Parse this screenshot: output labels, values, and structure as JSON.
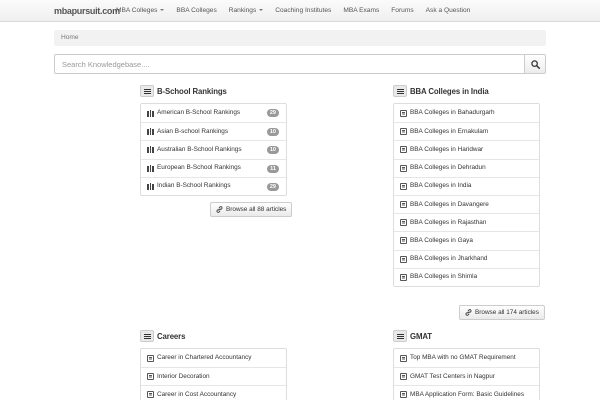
{
  "brand": "mbapursuit.com",
  "nav": [
    {
      "label": "MBA Colleges",
      "dropdown": true
    },
    {
      "label": "BBA Colleges",
      "dropdown": false
    },
    {
      "label": "Rankings",
      "dropdown": true
    },
    {
      "label": "Coaching Institutes",
      "dropdown": false
    },
    {
      "label": "MBA Exams",
      "dropdown": false
    },
    {
      "label": "Forums",
      "dropdown": false
    },
    {
      "label": "Ask a Question",
      "dropdown": false
    }
  ],
  "breadcrumb": "Home",
  "search": {
    "placeholder": "Search Knowledgebase...."
  },
  "sections": {
    "rankings": {
      "title": "B-School Rankings",
      "items": [
        {
          "label": "American B-School Rankings",
          "count": "29"
        },
        {
          "label": "Asian B-school Rankings",
          "count": "10"
        },
        {
          "label": "Australian B-School Rankings",
          "count": "10"
        },
        {
          "label": "European B-School Rankings",
          "count": "11"
        },
        {
          "label": "Indian B-School Rankings",
          "count": "29"
        }
      ],
      "browse": "Browse all 88 articles"
    },
    "bba": {
      "title": "BBA Colleges in India",
      "items": [
        {
          "label": "BBA Colleges in Bahadurgarh"
        },
        {
          "label": "BBA Colleges in Ernakulam"
        },
        {
          "label": "BBA Colleges in Haridwar"
        },
        {
          "label": "BBA Colleges in Dehradun"
        },
        {
          "label": "BBA Colleges in India"
        },
        {
          "label": "BBA Colleges in Davangere"
        },
        {
          "label": "BBA Colleges in Rajasthan"
        },
        {
          "label": "BBA Colleges in Gaya"
        },
        {
          "label": "BBA Colleges in Jharkhand"
        },
        {
          "label": "BBA Colleges in Shimla"
        }
      ],
      "browse": "Browse all 174 articles"
    },
    "careers": {
      "title": "Careers",
      "items": [
        {
          "label": "Career in Chartered Accountancy"
        },
        {
          "label": "Interior Decoration"
        },
        {
          "label": "Career in Cost Accountancy"
        }
      ]
    },
    "gmat": {
      "title": "GMAT",
      "items": [
        {
          "label": "Top MBA with no GMAT Requirement"
        },
        {
          "label": "GMAT Test Centers in Nagpur"
        },
        {
          "label": "MBA Application Form: Basic Guidelines"
        }
      ]
    }
  },
  "icons": {
    "search": "search-icon",
    "section": "list-icon",
    "category": "books-icon",
    "article": "document-icon",
    "browse": "link-icon"
  }
}
